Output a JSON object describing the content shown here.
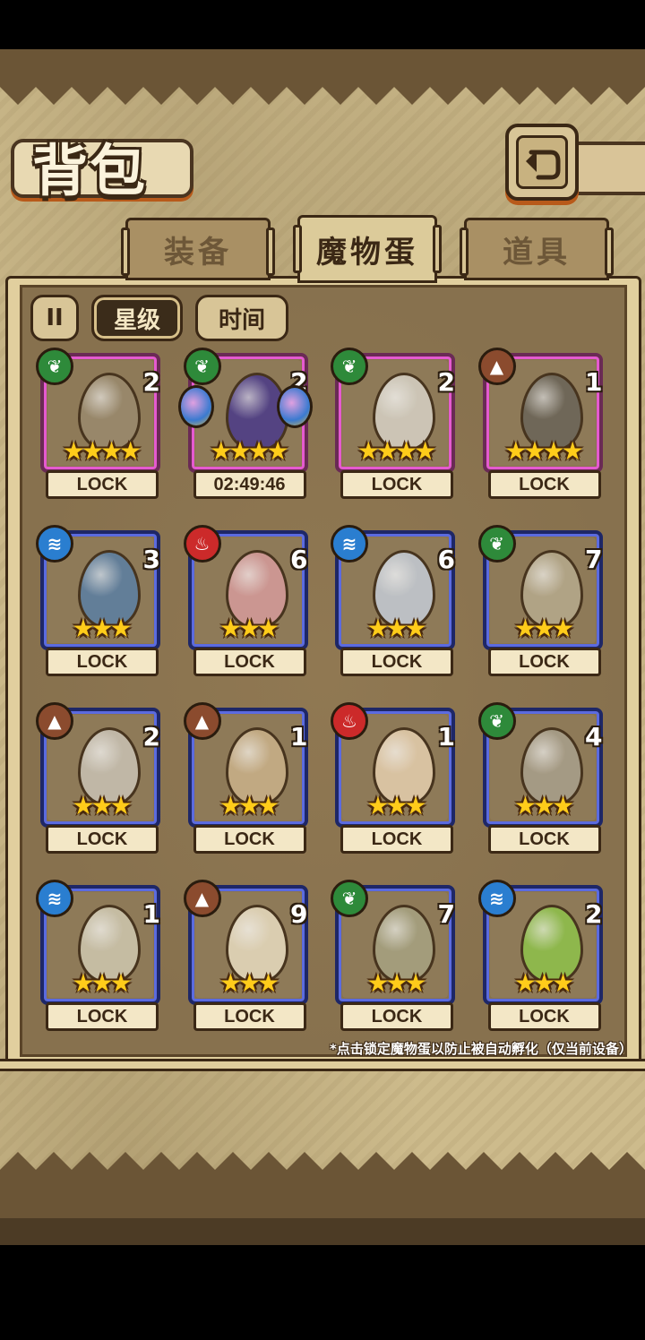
{
  "title": "背包",
  "tabs": [
    {
      "label": "装备",
      "active": false
    },
    {
      "label": "魔物蛋",
      "active": true
    },
    {
      "label": "道具",
      "active": false
    }
  ],
  "filters": {
    "toggle_icon": "II",
    "star_label": "星级",
    "time_label": "时间"
  },
  "items": [
    {
      "element": "leaf",
      "count": "2",
      "stars": "★★★★",
      "tier": "purple",
      "status": "LOCK",
      "egg_color": "#9a8a6e"
    },
    {
      "element": "leaf",
      "count": "2",
      "stars": "★★★★",
      "tier": "purple",
      "status": "02:49:46",
      "egg_color": "#4a3a8a"
    },
    {
      "element": "leaf",
      "count": "2",
      "stars": "★★★★",
      "tier": "purple",
      "status": "LOCK",
      "egg_color": "#d7d2c6"
    },
    {
      "element": "earth",
      "count": "1",
      "stars": "★★★★",
      "tier": "purple",
      "status": "LOCK",
      "egg_color": "#6a6458"
    },
    {
      "element": "water",
      "count": "3",
      "stars": "★★★",
      "tier": "blue",
      "status": "LOCK",
      "egg_color": "#5b7fa4"
    },
    {
      "element": "fire",
      "count": "6",
      "stars": "★★★",
      "tier": "blue",
      "status": "LOCK",
      "egg_color": "#d69b9b"
    },
    {
      "element": "water",
      "count": "6",
      "stars": "★★★",
      "tier": "blue",
      "status": "LOCK",
      "egg_color": "#c5ccd6"
    },
    {
      "element": "leaf",
      "count": "7",
      "stars": "★★★",
      "tier": "blue",
      "status": "LOCK",
      "egg_color": "#b7ab8e"
    },
    {
      "element": "earth",
      "count": "2",
      "stars": "★★★",
      "tier": "blue",
      "status": "LOCK",
      "egg_color": "#c9c2b4"
    },
    {
      "element": "earth",
      "count": "1",
      "stars": "★★★",
      "tier": "blue",
      "status": "LOCK",
      "egg_color": "#cbb28a"
    },
    {
      "element": "fire",
      "count": "1",
      "stars": "★★★",
      "tier": "blue",
      "status": "LOCK",
      "egg_color": "#e6cfae"
    },
    {
      "element": "leaf",
      "count": "4",
      "stars": "★★★",
      "tier": "blue",
      "status": "LOCK",
      "egg_color": "#a9a08c"
    },
    {
      "element": "water",
      "count": "1",
      "stars": "★★★",
      "tier": "blue",
      "status": "LOCK",
      "egg_color": "#cfc8b0"
    },
    {
      "element": "earth",
      "count": "9",
      "stars": "★★★",
      "tier": "blue",
      "status": "LOCK",
      "egg_color": "#e8dcc0"
    },
    {
      "element": "leaf",
      "count": "7",
      "stars": "★★★",
      "tier": "blue",
      "status": "LOCK",
      "egg_color": "#a7a382"
    },
    {
      "element": "water",
      "count": "2",
      "stars": "★★★",
      "tier": "blue",
      "status": "LOCK",
      "egg_color": "#8ec24a"
    }
  ],
  "footnote": "*点击锁定魔物蛋以防止被自动孵化（仅当前设备）",
  "element_icons": {
    "leaf": "leaf-icon",
    "water": "water-wave-icon",
    "fire": "flame-icon",
    "earth": "mountain-icon"
  },
  "colors": {
    "purple_frame": "#e55ad0",
    "blue_frame": "#5b6be0",
    "star": "#ffcc1a",
    "outline": "#3b2815"
  }
}
